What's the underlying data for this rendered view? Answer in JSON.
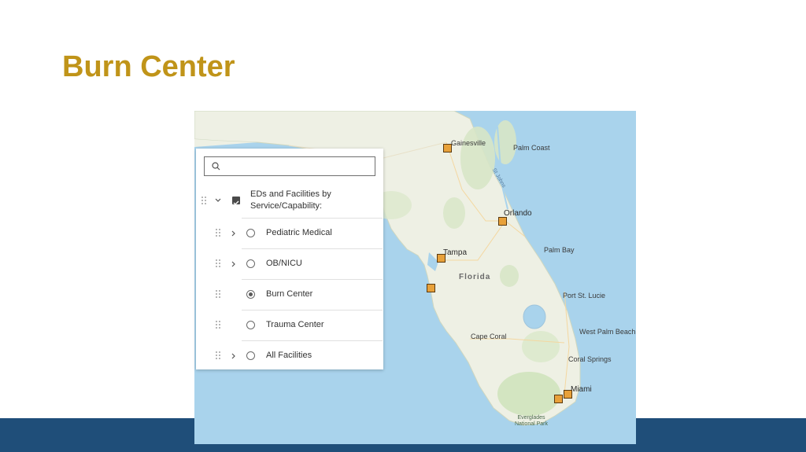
{
  "slide": {
    "title": "Burn Center"
  },
  "colors": {
    "title": "#c09419",
    "footer": "#1f4e79",
    "water": "#a9d3ec",
    "land": "#eef0e4",
    "marker": "#e8a13a"
  },
  "map": {
    "state_label": "Florida",
    "river_label": "St Johns",
    "park_label_line1": "Everglades",
    "park_label_line2": "National Park",
    "cities": {
      "gainesville": "Gainesville",
      "palm_coast": "Palm Coast",
      "orlando": "Orlando",
      "tampa": "Tampa",
      "palm_bay": "Palm Bay",
      "port_st_lucie": "Port St. Lucie",
      "west_palm_beach": "West Palm Beach",
      "cape_coral": "Cape Coral",
      "coral_springs": "Coral Springs",
      "miami": "Miami"
    }
  },
  "layer_list": {
    "search": {
      "placeholder": "",
      "value": ""
    },
    "group": {
      "label": "EDs and Facilities by Service/Capability:",
      "checked": true
    },
    "layers": [
      {
        "label": "Pediatric Medical",
        "selected": false,
        "expandable": true
      },
      {
        "label": "OB/NICU",
        "selected": false,
        "expandable": true
      },
      {
        "label": "Burn Center",
        "selected": true,
        "expandable": false
      },
      {
        "label": "Trauma Center",
        "selected": false,
        "expandable": false
      },
      {
        "label": "All Facilities",
        "selected": false,
        "expandable": true
      }
    ]
  }
}
